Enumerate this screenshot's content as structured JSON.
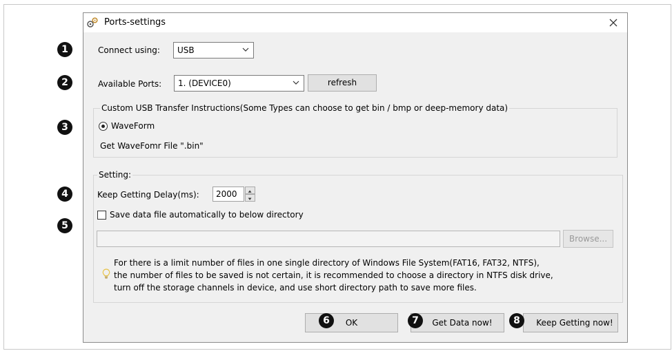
{
  "dialog": {
    "title": "Ports-settings",
    "close_glyph": "✕"
  },
  "badges": [
    "1",
    "2",
    "3",
    "4",
    "5",
    "6",
    "7",
    "8"
  ],
  "connect": {
    "label": "Connect using:",
    "selected": "USB"
  },
  "ports": {
    "label": "Available Ports:",
    "selected": "1. (DEVICE0)",
    "refresh_label": "refresh"
  },
  "custom_usb": {
    "group_title": "Custom USB Transfer Instructions(Some Types can choose to get bin / bmp or deep-memory data)",
    "radio_label": "WaveForm",
    "radio_checked": true,
    "description": "Get WaveFomr File \".bin\""
  },
  "setting": {
    "group_title": "Setting:",
    "delay_label": "Keep Getting Delay(ms):",
    "delay_value": "2000",
    "save_checkbox_label": "Save data file automatically to below directory",
    "save_checked": false,
    "directory_value": "",
    "browse_label": "Browse...",
    "tip_lines": [
      "For there is a limit number of files in one single directory of Windows File System(FAT16, FAT32, NTFS),",
      "the number of  files to be saved is not certain,  it is recommended to choose a directory in NTFS disk drive,",
      "turn off the storage channels in device, and use short directory path to save more files."
    ]
  },
  "footer": {
    "ok_label": "OK",
    "get_data_label": "Get Data now!",
    "keep_getting_label": "Keep Getting now!"
  },
  "colors": {
    "dialog_bg": "#f0f0f0",
    "badge_bg": "#111111",
    "tip_icon": "#e8c44a"
  }
}
